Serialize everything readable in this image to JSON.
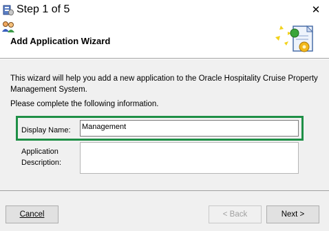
{
  "window": {
    "title": "Step 1 of 5",
    "close_glyph": "✕",
    "app_icon": "db-app-icon",
    "close_icon": "close-icon"
  },
  "header": {
    "title": "Add Application Wizard",
    "left_icon": "people-icon",
    "right_icon": "wizard-document-icon"
  },
  "body": {
    "intro_text": "This wizard will help you add a new application to the Oracle Hospitality Cruise Property Management System.",
    "complete_text": "Please complete the following information.",
    "display_name": {
      "label": "Display Name:",
      "value": "Management"
    },
    "application_description": {
      "label_line1": "Application",
      "label_line2": "Description:",
      "value": ""
    }
  },
  "footer": {
    "cancel_label": "Cancel",
    "back_label": "< Back",
    "next_label": "Next >",
    "back_enabled": false
  },
  "colors": {
    "highlight": "#1e8f46",
    "panel": "#f0f0f0",
    "button": "#e1e1e1"
  }
}
